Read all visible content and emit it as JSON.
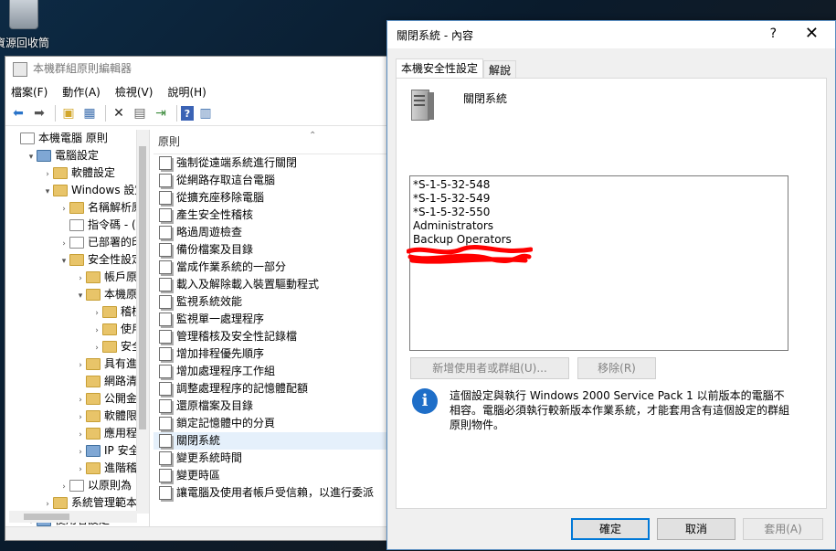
{
  "desktop": {
    "recycle_label": "資源回收筒"
  },
  "gpo": {
    "title": "本機群組原則編輯器",
    "menu": [
      "檔案(F)",
      "動作(A)",
      "檢視(V)",
      "說明(H)"
    ],
    "tree": [
      {
        "label": "本機電腦 原則",
        "indent": 0,
        "arrow": "",
        "icon": "doc"
      },
      {
        "label": "電腦設定",
        "indent": 1,
        "arrow": "▾",
        "icon": "pc"
      },
      {
        "label": "軟體設定",
        "indent": 2,
        "arrow": "›",
        "icon": "folder"
      },
      {
        "label": "Windows 設定",
        "indent": 2,
        "arrow": "▾",
        "icon": "folder"
      },
      {
        "label": "名稱解析原",
        "indent": 3,
        "arrow": "›",
        "icon": "folder"
      },
      {
        "label": "指令碼 - (I",
        "indent": 3,
        "arrow": "",
        "icon": "doc"
      },
      {
        "label": "已部署的印",
        "indent": 3,
        "arrow": "›",
        "icon": "doc"
      },
      {
        "label": "安全性設定",
        "indent": 3,
        "arrow": "▾",
        "icon": "folder"
      },
      {
        "label": "帳戶原",
        "indent": 4,
        "arrow": "›",
        "icon": "folder"
      },
      {
        "label": "本機原",
        "indent": 4,
        "arrow": "▾",
        "icon": "folder"
      },
      {
        "label": "稽核",
        "indent": 5,
        "arrow": "›",
        "icon": "folder"
      },
      {
        "label": "使用",
        "indent": 5,
        "arrow": "›",
        "icon": "folder"
      },
      {
        "label": "安全",
        "indent": 5,
        "arrow": "›",
        "icon": "folder"
      },
      {
        "label": "具有進",
        "indent": 4,
        "arrow": "›",
        "icon": "folder"
      },
      {
        "label": "網路清",
        "indent": 4,
        "arrow": "",
        "icon": "folder"
      },
      {
        "label": "公開金",
        "indent": 4,
        "arrow": "›",
        "icon": "folder"
      },
      {
        "label": "軟體限",
        "indent": 4,
        "arrow": "›",
        "icon": "folder"
      },
      {
        "label": "應用程",
        "indent": 4,
        "arrow": "›",
        "icon": "folder"
      },
      {
        "label": "IP 安全",
        "indent": 4,
        "arrow": "›",
        "icon": "pc"
      },
      {
        "label": "進階稽",
        "indent": 4,
        "arrow": "›",
        "icon": "folder"
      },
      {
        "label": "以原則為",
        "indent": 3,
        "arrow": "›",
        "icon": "doc"
      },
      {
        "label": "系統管理範本",
        "indent": 2,
        "arrow": "›",
        "icon": "folder"
      },
      {
        "label": "使用者設定",
        "indent": 1,
        "arrow": "▾",
        "icon": "pc"
      }
    ],
    "list_header": "原則",
    "policies": [
      "強制從遠端系統進行關閉",
      "從網路存取這台電腦",
      "從擴充座移除電腦",
      "產生安全性稽核",
      "略過周遊檢查",
      "備份檔案及目錄",
      "當成作業系統的一部分",
      "載入及解除載入裝置驅動程式",
      "監視系統效能",
      "監視單一處理程序",
      "管理稽核及安全性記錄檔",
      "增加排程優先順序",
      "增加處理程序工作組",
      "調整處理程序的記憶體配額",
      "還原檔案及目錄",
      "鎖定記憶體中的分頁",
      "關閉系統",
      "變更系統時間",
      "變更時區",
      "讓電腦及使用者帳戶受信賴，以進行委派"
    ],
    "selected_policy_index": 16
  },
  "dialog": {
    "title": "關閉系統 - 內容",
    "help": "?",
    "close": "✕",
    "tabs": [
      "本機安全性設定",
      "解說"
    ],
    "policy_name": "關閉系統",
    "members": [
      "*S-1-5-32-548",
      "*S-1-5-32-549",
      "*S-1-5-32-550",
      "Administrators",
      "Backup Operators"
    ],
    "add_button": "新增使用者或群組(U)...",
    "remove_button": "移除(R)",
    "info_text": "這個設定與執行 Windows 2000 Service Pack 1 以前版本的電腦不相容。電腦必須執行較新版本作業系統，才能套用含有這個設定的群組原則物件。",
    "ok": "確定",
    "cancel": "取消",
    "apply": "套用(A)"
  }
}
